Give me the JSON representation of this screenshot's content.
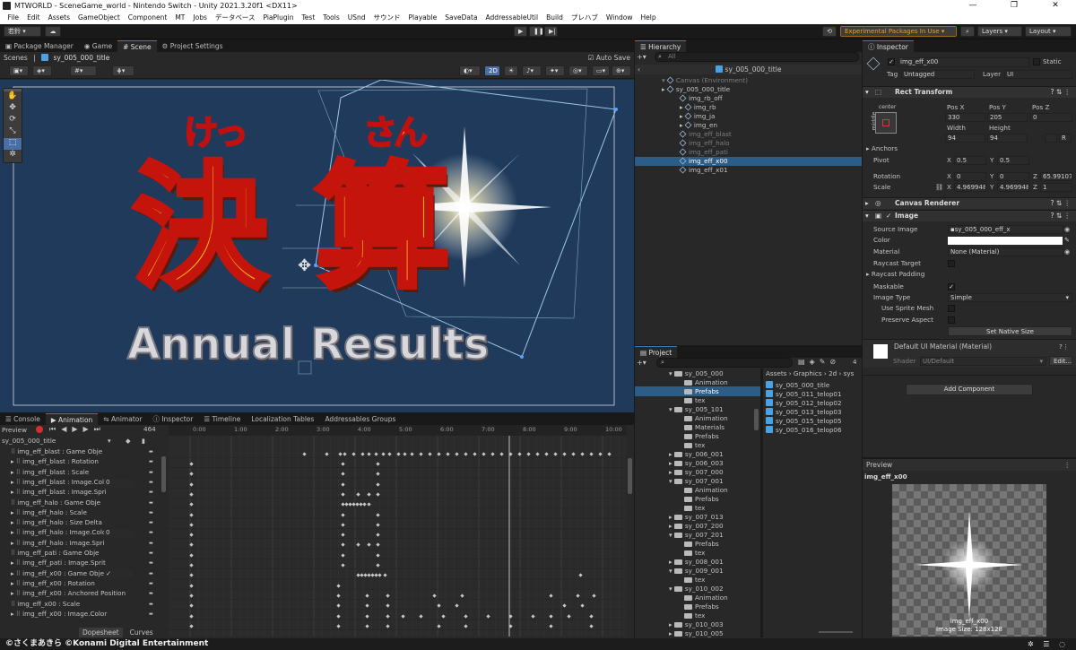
{
  "window": {
    "title": "MTWORLD - SceneGame_world - Nintendo Switch - Unity 2021.3.20f1 <DX11>",
    "buttons": [
      "—",
      "❐",
      "✕"
    ]
  },
  "menu": [
    "File",
    "Edit",
    "Assets",
    "GameObject",
    "Component",
    "MT",
    "Jobs",
    "データベース",
    "PiaPlugin",
    "Test",
    "Tools",
    "USnd",
    "サウンド",
    "Playable",
    "SaveData",
    "AddressableUtil",
    "Build",
    "プレハブ",
    "Window",
    "Help"
  ],
  "toolbar": {
    "account": "若鈴 ▾",
    "experimental": "Experimental Packages In Use ▾",
    "layers": "Layers",
    "layout": "Layout"
  },
  "scene": {
    "tabs": [
      "Package Manager",
      "Game",
      "Scene",
      "Project Settings"
    ],
    "breadcrumb_root": "Scenes",
    "breadcrumb_item": "sy_005_000_title",
    "auto_save": "Auto Save",
    "mode_2d": "2D",
    "furigana_left": "けっ",
    "furigana_right": "さん",
    "kanji_left": "決",
    "kanji_right": "算",
    "subtitle": "Annual Results"
  },
  "hierarchy": {
    "tab": "Hierarchy",
    "search": "All",
    "root": "sy_005_000_title",
    "canvas": "Canvas (Environment)",
    "items": [
      {
        "label": "sy_005_000_title",
        "indent": 1,
        "dim": false
      },
      {
        "label": "img_rb_off",
        "indent": 2,
        "dim": false
      },
      {
        "label": "img_rb",
        "indent": 2,
        "dim": false
      },
      {
        "label": "img_ja",
        "indent": 2,
        "dim": false
      },
      {
        "label": "img_en",
        "indent": 2,
        "dim": false
      },
      {
        "label": "img_eff_blast",
        "indent": 2,
        "dim": true
      },
      {
        "label": "img_eff_halo",
        "indent": 2,
        "dim": true
      },
      {
        "label": "img_eff_pati",
        "indent": 2,
        "dim": true
      },
      {
        "label": "img_eff_x00",
        "indent": 2,
        "dim": false,
        "selected": true
      },
      {
        "label": "img_eff_x01",
        "indent": 2,
        "dim": false
      }
    ]
  },
  "inspector": {
    "tab": "Inspector",
    "object_name": "img_eff_x00",
    "static": "Static",
    "tag_label": "Tag",
    "tag_value": "Untagged",
    "layer_label": "Layer",
    "layer_value": "UI",
    "rect_transform": "Rect Transform",
    "anchor_center": "center",
    "anchor_middle": "middle",
    "pos_x_label": "Pos X",
    "pos_y_label": "Pos Y",
    "pos_z_label": "Pos Z",
    "pos_x": "330",
    "pos_y": "205",
    "pos_z": "0",
    "width_label": "Width",
    "height_label": "Height",
    "width": "94",
    "height": "94",
    "anchors": "Anchors",
    "pivot": "Pivot",
    "pivot_x": "0.5",
    "pivot_y": "0.5",
    "rotation": "Rotation",
    "rot_x": "0",
    "rot_y": "0",
    "rot_z": "65.99107",
    "scale": "Scale",
    "scale_x": "4.969948",
    "scale_y": "4.969948",
    "scale_z": "1",
    "canvas_renderer": "Canvas Renderer",
    "image": "Image",
    "source_image_label": "Source Image",
    "source_image": "sy_005_000_eff_x",
    "color_label": "Color",
    "material_label": "Material",
    "material": "None (Material)",
    "raycast_target": "Raycast Target",
    "raycast_padding": "Raycast Padding",
    "maskable": "Maskable",
    "image_type_label": "Image Type",
    "image_type": "Simple",
    "use_sprite_mesh": "Use Sprite Mesh",
    "preserve_aspect": "Preserve Aspect",
    "set_native_size": "Set Native Size",
    "default_material": "Default UI Material (Material)",
    "shader_label": "Shader",
    "shader": "UI/Default",
    "edit": "Edit...",
    "add_component": "Add Component",
    "preview_tab": "Preview",
    "preview_name": "img_eff_x00",
    "preview_caption": "img_eff_x00",
    "preview_size": "Image Size: 128x128"
  },
  "animation": {
    "tabs": [
      "Console",
      "Animation",
      "Animator",
      "Inspector",
      "Timeline",
      "Localization Tables",
      "Addressables Groups"
    ],
    "preview": "Preview",
    "frame": "464",
    "clip": "sy_005_000_title",
    "ruler": [
      "0:00",
      "1:00",
      "2:00",
      "3:00",
      "4:00",
      "5:00",
      "6:00",
      "7:00",
      "8:00",
      "9:00",
      "10:00"
    ],
    "props": [
      {
        "label": "img_eff_blast : Game Obje",
        "value": ""
      },
      {
        "label": "img_eff_blast : Rotation",
        "value": ""
      },
      {
        "label": "img_eff_blast : Scale",
        "value": ""
      },
      {
        "label": "img_eff_blast : Image.Colo",
        "value": "0"
      },
      {
        "label": "img_eff_blast : Image.Spri",
        "value": ""
      },
      {
        "label": "img_eff_halo : Game Obje",
        "value": ""
      },
      {
        "label": "img_eff_halo : Scale",
        "value": ""
      },
      {
        "label": "img_eff_halo : Size Delta",
        "value": ""
      },
      {
        "label": "img_eff_halo : Image.Colo",
        "value": "0"
      },
      {
        "label": "img_eff_halo : Image.Spri",
        "value": ""
      },
      {
        "label": "img_eff_pati : Game Obje",
        "value": ""
      },
      {
        "label": "img_eff_pati : Image.Sprit",
        "value": ""
      },
      {
        "label": "img_eff_x00 : Game Obje",
        "value": "✓"
      },
      {
        "label": "img_eff_x00 : Rotation",
        "value": ""
      },
      {
        "label": "img_eff_x00 : Anchored Position",
        "value": ""
      },
      {
        "label": "img_eff_x00 : Scale",
        "value": ""
      },
      {
        "label": "img_eff_x00 : Image.Color",
        "value": ""
      }
    ],
    "bottom_tabs": [
      "Dopesheet",
      "Curves"
    ]
  },
  "project": {
    "tab": "Project",
    "path": [
      "Assets",
      "Graphics",
      "2d",
      "sys"
    ],
    "tree": [
      {
        "label": "sy_005_000",
        "indent": 0,
        "open": true
      },
      {
        "label": "Animation",
        "indent": 1
      },
      {
        "label": "Prefabs",
        "indent": 1,
        "selected": true
      },
      {
        "label": "tex",
        "indent": 1
      },
      {
        "label": "sy_005_101",
        "indent": 0,
        "open": true
      },
      {
        "label": "Animation",
        "indent": 1
      },
      {
        "label": "Materials",
        "indent": 1
      },
      {
        "label": "Prefabs",
        "indent": 1
      },
      {
        "label": "tex",
        "indent": 1
      },
      {
        "label": "sy_006_001",
        "indent": 0
      },
      {
        "label": "sy_006_003",
        "indent": 0
      },
      {
        "label": "sy_007_000",
        "indent": 0
      },
      {
        "label": "sy_007_001",
        "indent": 0,
        "open": true
      },
      {
        "label": "Animation",
        "indent": 1
      },
      {
        "label": "Prefabs",
        "indent": 1
      },
      {
        "label": "tex",
        "indent": 1
      },
      {
        "label": "sy_007_013",
        "indent": 0
      },
      {
        "label": "sy_007_200",
        "indent": 0
      },
      {
        "label": "sy_007_201",
        "indent": 0,
        "open": true
      },
      {
        "label": "Prefabs",
        "indent": 1
      },
      {
        "label": "tex",
        "indent": 1
      },
      {
        "label": "sy_008_001",
        "indent": 0
      },
      {
        "label": "sy_009_001",
        "indent": 0,
        "open": true
      },
      {
        "label": "tex",
        "indent": 1
      },
      {
        "label": "sy_010_002",
        "indent": 0,
        "open": true
      },
      {
        "label": "Animation",
        "indent": 1
      },
      {
        "label": "Prefabs",
        "indent": 1
      },
      {
        "label": "tex",
        "indent": 1
      },
      {
        "label": "sy_010_003",
        "indent": 0
      },
      {
        "label": "sy_010_005",
        "indent": 0
      }
    ],
    "files": [
      "sy_005_000_title",
      "sy_005_011_telop01",
      "sy_005_012_telop02",
      "sy_005_013_telop03",
      "sy_005_015_telop05",
      "sy_005_016_telop06"
    ],
    "count": "4"
  },
  "copyright": "©さくまあきら ©Konami Digital Entertainment",
  "colors": {
    "accent": "#3a79bb",
    "selection": "#2c5d87",
    "scene_bg": "#1f3a5b",
    "keyframe": "#c8c8c8",
    "playhead": "#ffffff"
  }
}
